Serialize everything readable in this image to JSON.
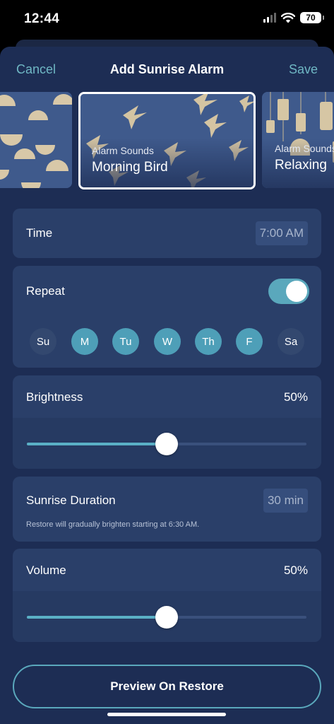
{
  "status_bar": {
    "time": "12:44",
    "battery": "70"
  },
  "nav": {
    "cancel_label": "Cancel",
    "title": "Add Sunrise Alarm",
    "save_label": "Save"
  },
  "sounds": {
    "cards": [
      {
        "category": "",
        "name": ""
      },
      {
        "category": "Alarm Sounds",
        "name": "Morning Bird",
        "selected": true
      },
      {
        "category": "Alarm Sounds",
        "name": "Relaxing"
      }
    ]
  },
  "time_row": {
    "label": "Time",
    "value": "7:00 AM"
  },
  "repeat": {
    "label": "Repeat",
    "enabled": true,
    "days": [
      {
        "label": "Su",
        "on": false
      },
      {
        "label": "M",
        "on": true
      },
      {
        "label": "Tu",
        "on": true
      },
      {
        "label": "W",
        "on": true
      },
      {
        "label": "Th",
        "on": true
      },
      {
        "label": "F",
        "on": true
      },
      {
        "label": "Sa",
        "on": false
      }
    ]
  },
  "brightness": {
    "label": "Brightness",
    "value_text": "50%",
    "value": 0.5
  },
  "sunrise_duration": {
    "label": "Sunrise Duration",
    "value": "30 min",
    "hint": "Restore will gradually brighten starting at 6:30 AM."
  },
  "volume": {
    "label": "Volume",
    "value_text": "50%",
    "value": 0.5
  },
  "preview_button": {
    "label": "Preview On Restore"
  },
  "colors": {
    "accent": "#5aa8bc",
    "sheet": "#1d2d54",
    "panel": "#2a3f69"
  }
}
